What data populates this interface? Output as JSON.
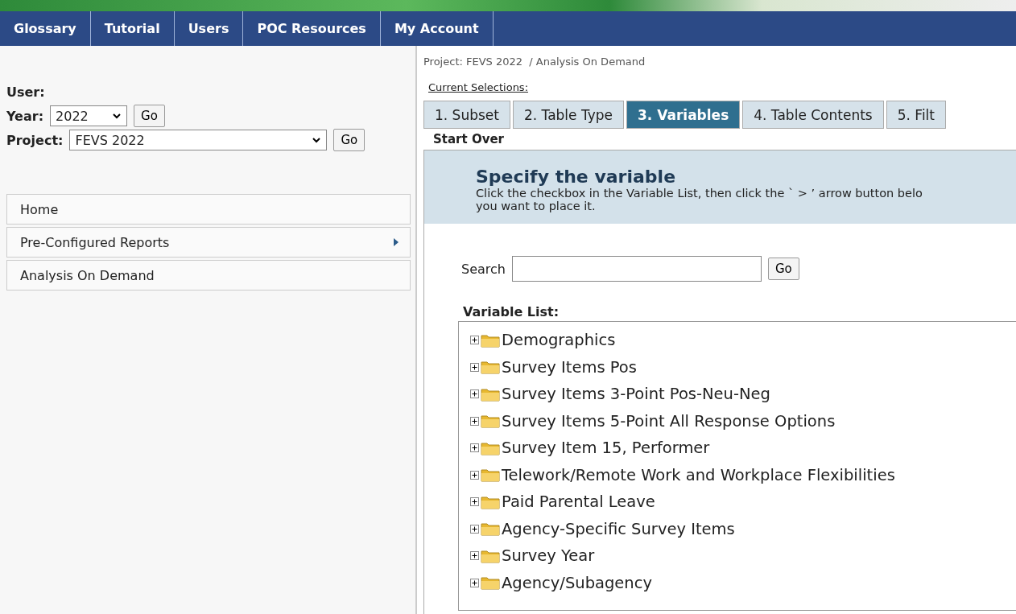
{
  "nav": [
    {
      "label": "Glossary"
    },
    {
      "label": "Tutorial"
    },
    {
      "label": "Users"
    },
    {
      "label": "POC Resources"
    },
    {
      "label": "My Account"
    }
  ],
  "sidebar": {
    "user_label": "User:",
    "year_label": "Year:",
    "year_value": "2022",
    "year_go": "Go",
    "project_label": "Project:",
    "project_value": "FEVS 2022",
    "project_go": "Go",
    "items": [
      {
        "label": "Home",
        "submenu": false
      },
      {
        "label": "Pre-Configured Reports",
        "submenu": true
      },
      {
        "label": "Analysis On Demand",
        "submenu": false
      }
    ]
  },
  "breadcrumb": "Project: FEVS 2022  / Analysis On Demand",
  "current_selections": "Current Selections:",
  "steps": [
    {
      "label": "1. Subset",
      "selected": false
    },
    {
      "label": "2. Table Type",
      "selected": false
    },
    {
      "label": "3. Variables",
      "selected": true
    },
    {
      "label": "4. Table Contents",
      "selected": false
    },
    {
      "label": "5. Filt",
      "selected": false
    }
  ],
  "start_over": "Start Over",
  "panel": {
    "title": "Specify the variable",
    "description": "Click the checkbox in the Variable List, then click the ` > ’ arrow button belo",
    "description_2": "you want to place it.",
    "search_label": "Search",
    "search_button": "Go",
    "list_label": "Variable List:"
  },
  "variables": [
    {
      "label": "Demographics",
      "expanded": false
    },
    {
      "label": "Survey Items Pos",
      "expanded": false
    },
    {
      "label": "Survey Items 3-Point Pos-Neu-Neg",
      "expanded": false
    },
    {
      "label": "Survey Items 5-Point All Response Options",
      "expanded": false
    },
    {
      "label": "Survey Item 15, Performer",
      "expanded": false
    },
    {
      "label": "Telework/Remote Work and Workplace Flexibilities",
      "expanded": false
    },
    {
      "label": "Paid Parental Leave",
      "expanded": false
    },
    {
      "label": "Agency-Specific Survey Items",
      "expanded": false
    },
    {
      "label": "Survey Year",
      "expanded": false
    },
    {
      "label": "Agency/Subagency",
      "expanded": false
    }
  ]
}
